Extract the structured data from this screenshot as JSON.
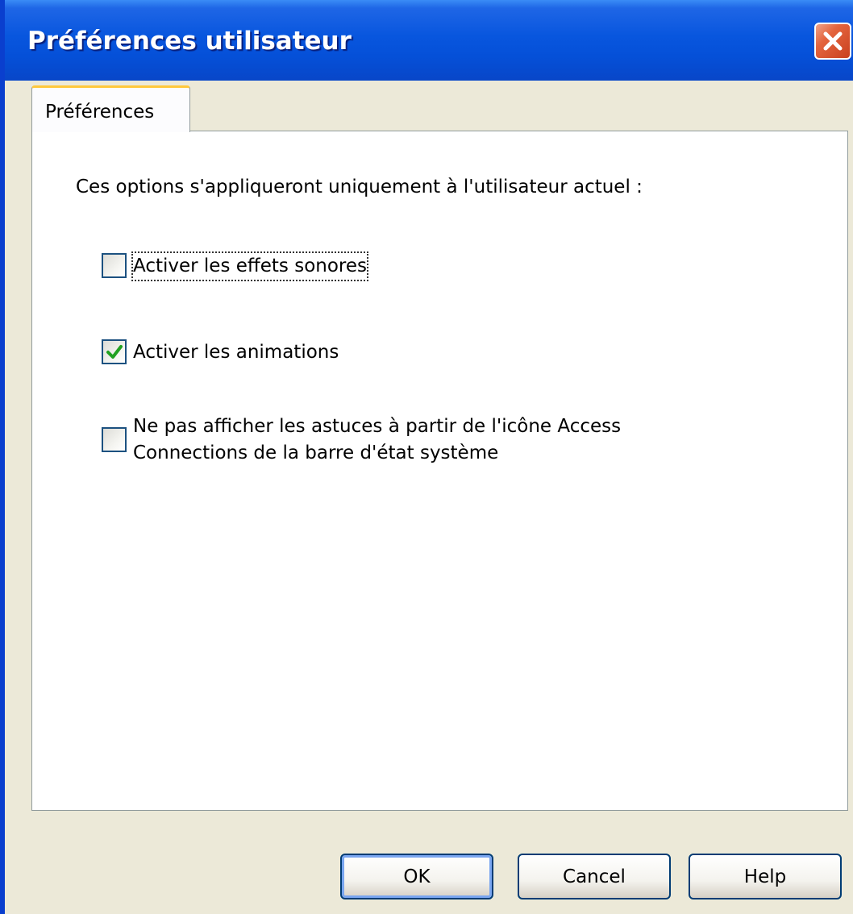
{
  "window": {
    "title": "Préférences utilisateur"
  },
  "tabs": [
    {
      "label": "Préférences"
    }
  ],
  "panel": {
    "intro": "Ces options s'appliqueront uniquement à l'utilisateur actuel :",
    "options": [
      {
        "label": "Activer les effets sonores",
        "checked": false
      },
      {
        "label": "Activer les animations",
        "checked": true
      },
      {
        "label_line1": "Ne pas afficher les astuces à partir de l'icône Access",
        "label_line2": "Connections de la barre d'état système",
        "checked": false
      }
    ]
  },
  "buttons": {
    "ok": "OK",
    "cancel": "Cancel",
    "help": "Help"
  },
  "icons": {
    "close": "close-icon",
    "check": "checkmark-icon"
  },
  "colors": {
    "titlebar": "#0856de",
    "close": "#e4653e",
    "tab_accent": "#ffc83c",
    "check": "#21a121"
  }
}
